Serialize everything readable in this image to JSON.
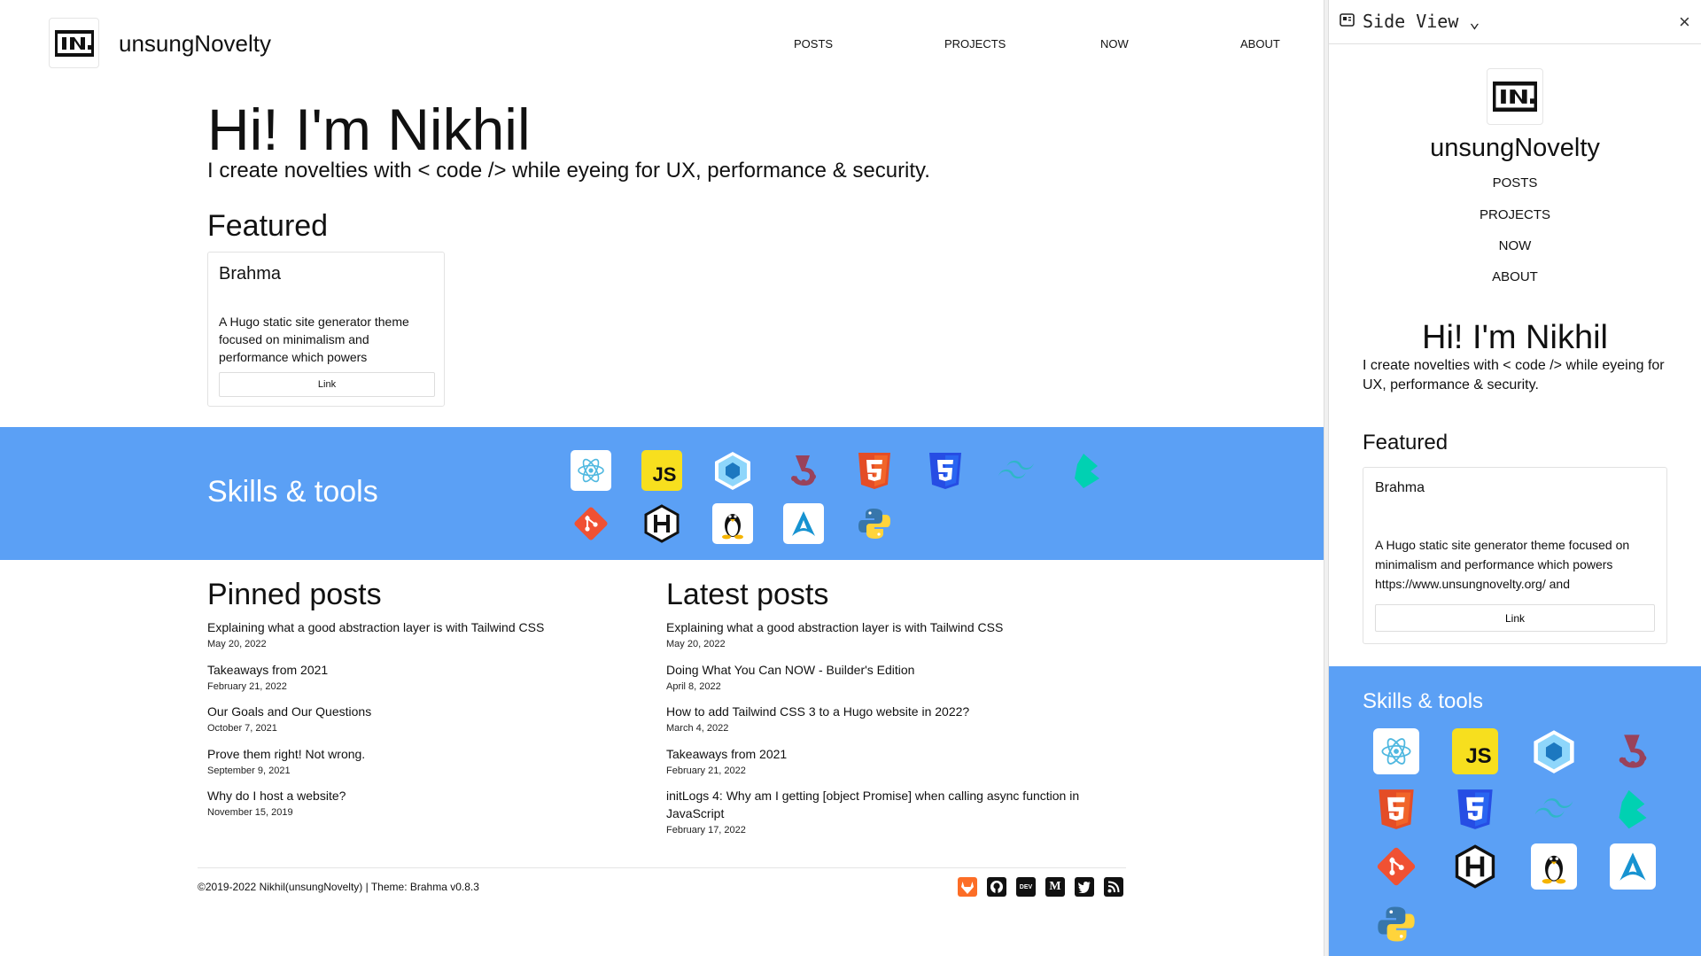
{
  "site": {
    "brand": "unsungNovelty",
    "nav": [
      "POSTS",
      "PROJECTS",
      "NOW",
      "ABOUT"
    ]
  },
  "hero": {
    "title": "Hi! I'm Nikhil",
    "subtitle": "I create novelties with < code /> while eyeing for UX, performance & security."
  },
  "featured": {
    "heading": "Featured",
    "card_title": "Brahma",
    "card_desc": "A Hugo static site generator theme focused on minimalism and performance which powers",
    "card_desc_side": "A Hugo static site generator theme focused on minimalism and performance which powers https://www.unsungnovelty.org/ and",
    "card_button": "Link"
  },
  "skills": {
    "heading": "Skills & tools",
    "icons": [
      "react-icon",
      "javascript-icon",
      "webpack-icon",
      "jest-icon",
      "html5-icon",
      "css3-icon",
      "tailwind-icon",
      "bulma-icon",
      "git-icon",
      "hugo-icon",
      "linux-icon",
      "arch-linux-icon",
      "python-icon"
    ],
    "js_label": "JS"
  },
  "pinned": {
    "heading": "Pinned posts",
    "posts": [
      {
        "title": "Explaining what a good abstraction layer is with Tailwind CSS",
        "date": "May 20, 2022"
      },
      {
        "title": "Takeaways from 2021",
        "date": "February 21, 2022"
      },
      {
        "title": "Our Goals and Our Questions",
        "date": "October 7, 2021"
      },
      {
        "title": "Prove them right! Not wrong.",
        "date": "September 9, 2021"
      },
      {
        "title": "Why do I host a website?",
        "date": "November 15, 2019"
      }
    ]
  },
  "latest": {
    "heading": "Latest posts",
    "posts": [
      {
        "title": "Explaining what a good abstraction layer is with Tailwind CSS",
        "date": "May 20, 2022"
      },
      {
        "title": "Doing What You Can NOW - Builder's Edition",
        "date": "April 8, 2022"
      },
      {
        "title": "How to add Tailwind CSS 3 to a Hugo website in 2022?",
        "date": "March 4, 2022"
      },
      {
        "title": "Takeaways from 2021",
        "date": "February 21, 2022"
      },
      {
        "title": "initLogs 4: Why am I getting [object Promise] when calling async function in JavaScript",
        "date": "February 17, 2022"
      }
    ]
  },
  "footer": {
    "text": "©2019-2022 Nikhil(unsungNovelty) | Theme: Brahma v0.8.3",
    "dev_label": "DEV",
    "medium_label": "M",
    "icons": [
      "gitlab-icon",
      "github-icon",
      "dev-icon",
      "medium-icon",
      "twitter-icon",
      "rss-icon"
    ]
  },
  "side_view": {
    "title": "Side View ⌄",
    "close": "×"
  },
  "colors": {
    "skills_bg": "#5ba0f5",
    "accent": "#111111"
  }
}
